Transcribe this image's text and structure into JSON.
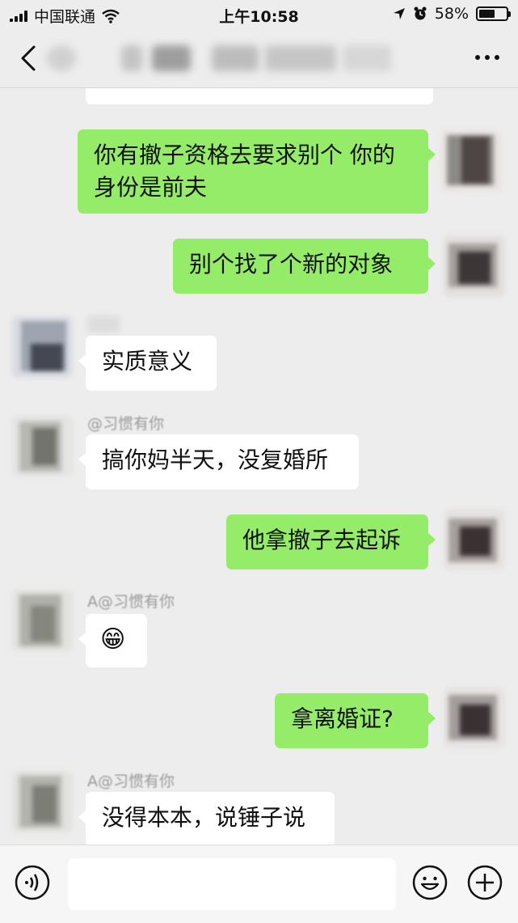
{
  "status_bar": {
    "carrier": "中国联通",
    "time": "上午10:58",
    "battery_percent": "58%",
    "battery_level": 0.58
  },
  "messages": [
    {
      "id": 1,
      "side": "out",
      "text": "你有撤子资格去要求别个 你的身份是前夫"
    },
    {
      "id": 2,
      "side": "out",
      "text": "别个找了个新的对象"
    },
    {
      "id": 3,
      "side": "in",
      "text": "实质意义"
    },
    {
      "id": 4,
      "side": "in",
      "sender": "@习惯有你",
      "text": "搞你妈半天，没复婚所"
    },
    {
      "id": 5,
      "side": "out",
      "text": "他拿撤子去起诉"
    },
    {
      "id": 6,
      "side": "in",
      "sender": "A@习惯有你",
      "text": "😁"
    },
    {
      "id": 7,
      "side": "out",
      "text": "拿离婚证?"
    },
    {
      "id": 8,
      "side": "in",
      "sender": "A@习惯有你",
      "text": "没得本本，说锤子说"
    }
  ],
  "icons": {
    "back": "chevron-left-icon",
    "more": "more-icon",
    "voice": "voice-icon",
    "emoji": "emoji-icon",
    "add": "plus-icon"
  }
}
